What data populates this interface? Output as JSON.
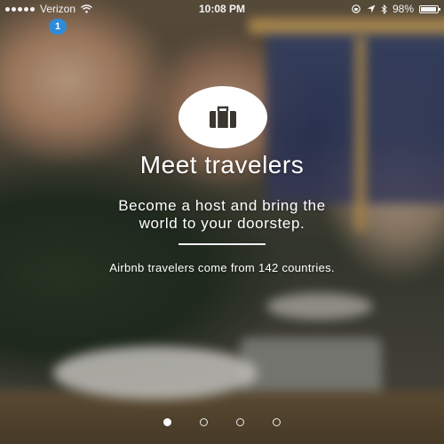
{
  "status_bar": {
    "carrier": "Verizon",
    "time": "10:08 PM",
    "battery": "98%",
    "signal_icon": "signal-dots-icon",
    "wifi_icon": "wifi-icon",
    "location_icon": "location-arrow-icon",
    "bluetooth_icon": "bluetooth-icon",
    "lock_icon": "rotation-lock-icon",
    "battery_icon": "battery-icon"
  },
  "notification": {
    "badge_count": "1"
  },
  "onboarding": {
    "icon": "suitcase-icon",
    "title": "Meet travelers",
    "subtitle_line1": "Become a host and bring the",
    "subtitle_line2": "world to your doorstep.",
    "stat_text": "Airbnb travelers come from 142 countries."
  },
  "pager": {
    "total_pages": 4,
    "active_page": 1
  },
  "colors": {
    "badge": "#2e8bd8",
    "text": "#ffffff"
  }
}
